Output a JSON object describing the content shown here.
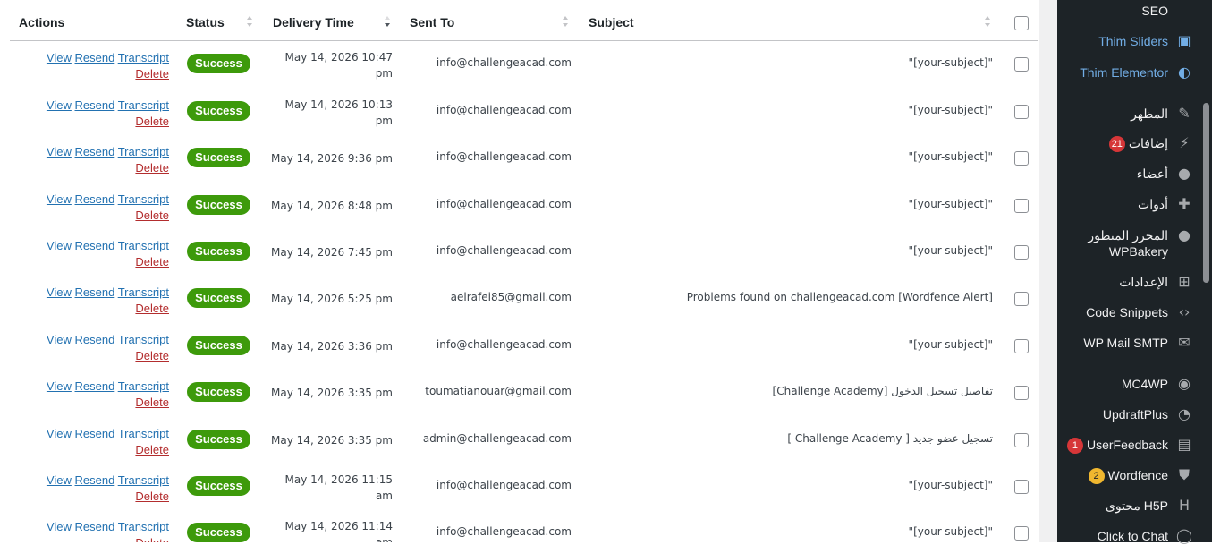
{
  "table": {
    "headers": {
      "actions": "Actions",
      "status": "Status",
      "delivery_time": "Delivery Time",
      "sent_to": "Sent To",
      "subject": "Subject"
    },
    "action_labels": {
      "view": "View",
      "resend": "Resend",
      "transcript": "Transcript",
      "delete": "Delete"
    },
    "rows": [
      {
        "status": "Success",
        "time_line1": "May 14, 2026 10:47",
        "time_line2": "pm",
        "sent_to": "info@challengeacad.com",
        "subject": "\"[your-subject]\""
      },
      {
        "status": "Success",
        "time_line1": "May 14, 2026 10:13",
        "time_line2": "pm",
        "sent_to": "info@challengeacad.com",
        "subject": "\"[your-subject]\""
      },
      {
        "status": "Success",
        "time_line1": "May 14, 2026 9:36 pm",
        "time_line2": "",
        "sent_to": "info@challengeacad.com",
        "subject": "\"[your-subject]\""
      },
      {
        "status": "Success",
        "time_line1": "May 14, 2026 8:48 pm",
        "time_line2": "",
        "sent_to": "info@challengeacad.com",
        "subject": "\"[your-subject]\""
      },
      {
        "status": "Success",
        "time_line1": "May 14, 2026 7:45 pm",
        "time_line2": "",
        "sent_to": "info@challengeacad.com",
        "subject": "\"[your-subject]\""
      },
      {
        "status": "Success",
        "time_line1": "May 14, 2026 5:25 pm",
        "time_line2": "",
        "sent_to": "aelrafei85@gmail.com",
        "subject": "Problems found on challengeacad.com [Wordfence Alert]"
      },
      {
        "status": "Success",
        "time_line1": "May 14, 2026 3:36 pm",
        "time_line2": "",
        "sent_to": "info@challengeacad.com",
        "subject": "\"[your-subject]\""
      },
      {
        "status": "Success",
        "time_line1": "May 14, 2026 3:35 pm",
        "time_line2": "",
        "sent_to": "toumatianouar@gmail.com",
        "subject": "[Challenge Academy] تفاصيل تسجيل الدخول"
      },
      {
        "status": "Success",
        "time_line1": "May 14, 2026 3:35 pm",
        "time_line2": "",
        "sent_to": "admin@challengeacad.com",
        "subject": "[ Challenge Academy ] تسجيل عضو جديد"
      },
      {
        "status": "Success",
        "time_line1": "May 14, 2026 11:15",
        "time_line2": "am",
        "sent_to": "info@challengeacad.com",
        "subject": "\"[your-subject]\""
      },
      {
        "status": "Success",
        "time_line1": "May 14, 2026 11:14",
        "time_line2": "am",
        "sent_to": "info@challengeacad.com",
        "subject": "\"[your-subject]\""
      }
    ]
  },
  "sidebar": {
    "items": [
      {
        "label": "SEO",
        "icon": "seo-icon",
        "style": "normal"
      },
      {
        "label": "Thim Sliders",
        "icon": "slides-icon",
        "style": "blue"
      },
      {
        "label": "Thim Elementor",
        "icon": "elementor-icon",
        "style": "blue"
      },
      {
        "label": "المظهر",
        "icon": "paintbrush-icon",
        "style": "normal"
      },
      {
        "label": "إضافات",
        "icon": "plugins-icon",
        "style": "normal",
        "count": "21"
      },
      {
        "label": "أعضاء",
        "icon": "users-icon",
        "style": "normal"
      },
      {
        "label": "أدوات",
        "icon": "tools-icon",
        "style": "normal"
      },
      {
        "label": "المحرر المتطور",
        "label2": "WPBakery",
        "icon": "chat-bubble-icon",
        "style": "normal"
      },
      {
        "label": "الإعدادات",
        "icon": "settings-icon",
        "style": "normal"
      },
      {
        "label": "Code Snippets",
        "icon": "code-icon",
        "style": "normal"
      },
      {
        "label": "WP Mail SMTP",
        "icon": "mail-icon",
        "style": "normal"
      },
      {
        "label": "MC4WP",
        "icon": "mc4wp-icon",
        "style": "normal"
      },
      {
        "label": "UpdraftPlus",
        "icon": "updraft-icon",
        "style": "normal"
      },
      {
        "label": "UserFeedback",
        "icon": "chart-icon",
        "style": "normal",
        "count": "1"
      },
      {
        "label": "Wordfence",
        "icon": "wordfence-icon",
        "style": "normal",
        "count": "2"
      },
      {
        "label": "محتوى H5P",
        "icon": "h5p-icon",
        "style": "normal"
      },
      {
        "label": "Click to Chat",
        "icon": "whatsapp-icon",
        "style": "normal"
      }
    ]
  },
  "colors": {
    "success": "#3d9a0b",
    "link": "#2271b1",
    "delete": "#b32d2e",
    "sidebar_bg": "#1d2327",
    "sidebar_link": "#72aee6",
    "badge_red": "#d63638",
    "badge_orange": "#f0b72f"
  }
}
